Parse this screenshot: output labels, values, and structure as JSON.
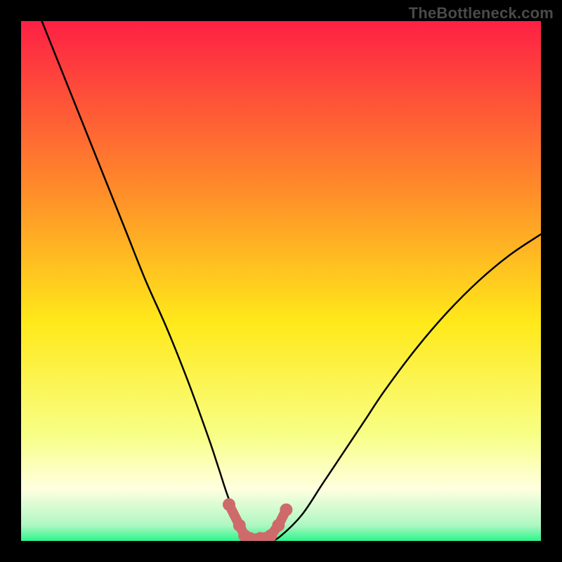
{
  "watermark": "TheBottleneck.com",
  "colors": {
    "frame": "#000000",
    "curve": "#000000",
    "marker_fill": "#cf6a6a",
    "marker_stroke": "#cf6a6a",
    "gradient_top": "#fe2045",
    "gradient_mid_upper": "#ff8a2a",
    "gradient_mid": "#ffe91a",
    "gradient_mid_lower": "#f8ff88",
    "gradient_pale": "#ffffe0",
    "gradient_green": "#2bf58a"
  },
  "chart_data": {
    "type": "line",
    "title": "",
    "xlabel": "",
    "ylabel": "",
    "xlim": [
      0,
      100
    ],
    "ylim": [
      0,
      100
    ],
    "x": [
      4,
      8,
      12,
      16,
      20,
      24,
      28,
      32,
      36,
      38,
      40,
      42,
      44,
      46,
      48,
      50,
      54,
      58,
      62,
      66,
      70,
      76,
      82,
      88,
      94,
      100
    ],
    "values": [
      100,
      90,
      80,
      70,
      60,
      50,
      41,
      31,
      20,
      14,
      8,
      4,
      1,
      0,
      0,
      1,
      5,
      11,
      17,
      23,
      29,
      37,
      44,
      50,
      55,
      59
    ],
    "markers": {
      "x": [
        40,
        42,
        43,
        44,
        46,
        48,
        49.5,
        51
      ],
      "y": [
        7,
        3,
        1,
        0.5,
        0.5,
        1,
        3,
        6
      ]
    }
  }
}
